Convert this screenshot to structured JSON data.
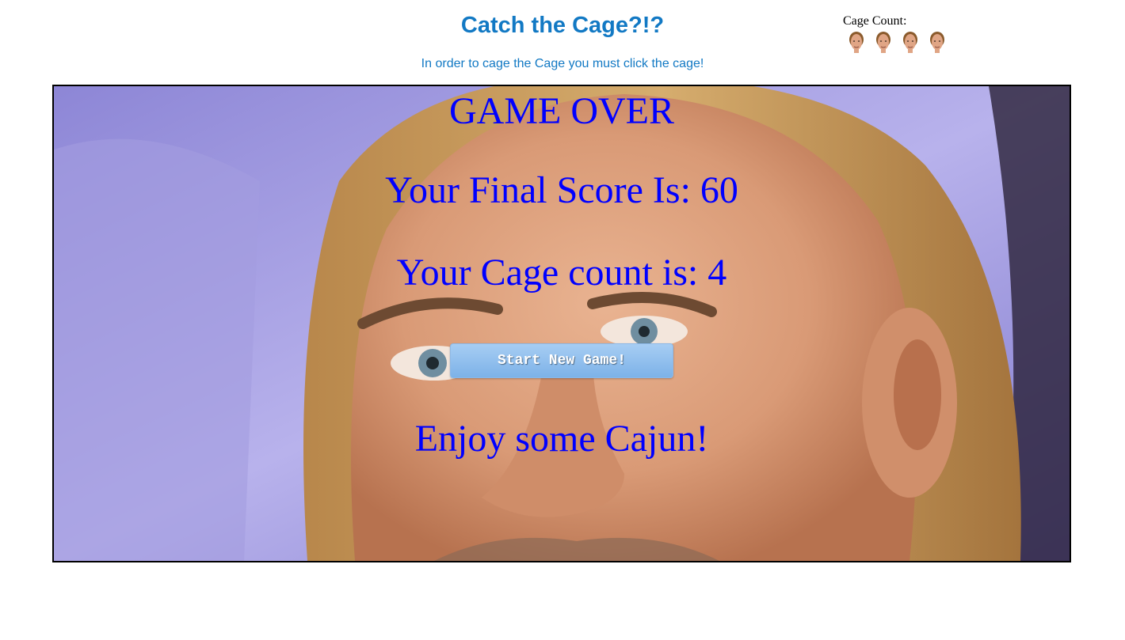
{
  "header": {
    "title": "Catch the Cage?!?",
    "subtitle": "In order to cage the Cage you must click the cage!"
  },
  "cage_count_panel": {
    "label": "Cage Count:",
    "icons": [
      "cage-face-icon",
      "cage-face-icon",
      "cage-face-icon",
      "cage-face-icon"
    ]
  },
  "game": {
    "game_over": "GAME OVER",
    "final_score": "Your Final Score Is: 60",
    "cage_count": "Your Cage count is: 4",
    "start_button": "Start New Game!",
    "closing": "Enjoy some Cajun!"
  },
  "colors": {
    "header_blue": "#1279c4",
    "overlay_text": "#0000ff",
    "button_top": "#a7cdf3",
    "button_bottom": "#7db2e8"
  }
}
